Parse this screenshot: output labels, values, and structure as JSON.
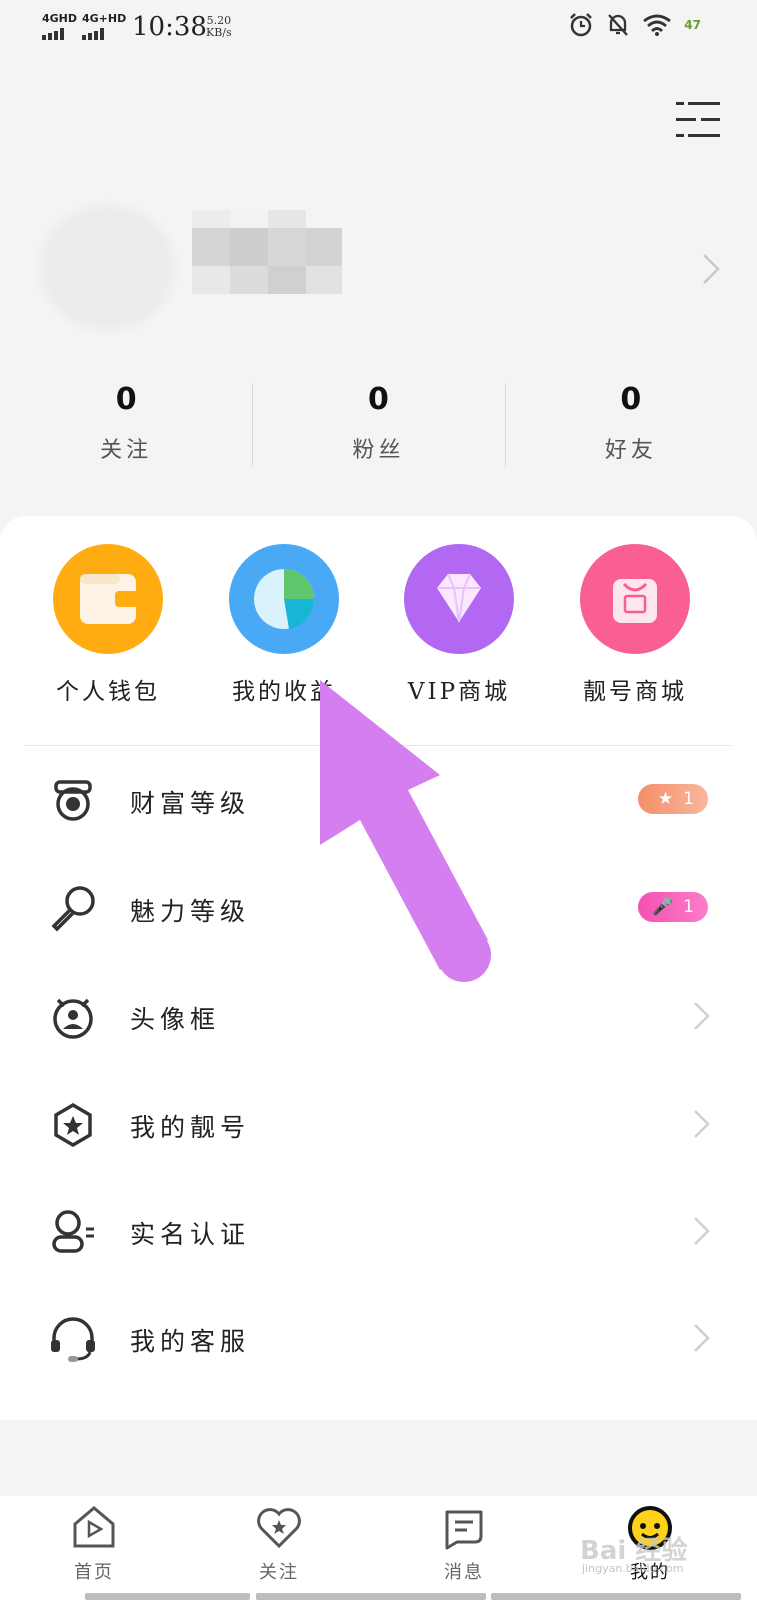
{
  "status_bar": {
    "network1": "4GHD",
    "network2": "4G+HD",
    "time": "10:38",
    "speed_value": "5.20",
    "speed_unit": "KB/s",
    "battery": "47",
    "icons": [
      "alarm-icon",
      "mute-icon",
      "wifi-icon",
      "battery-icon"
    ]
  },
  "stats": [
    {
      "value": "0",
      "label": "关注"
    },
    {
      "value": "0",
      "label": "粉丝"
    },
    {
      "value": "0",
      "label": "好友"
    }
  ],
  "quick_actions": [
    {
      "label": "个人钱包",
      "icon": "wallet-icon",
      "color": "#ffac12"
    },
    {
      "label": "我的收益",
      "icon": "pie-chart-icon",
      "color": "#4aa9f5"
    },
    {
      "label": "VIP商城",
      "icon": "diamond-icon",
      "color": "#b268f3"
    },
    {
      "label": "靓号商城",
      "icon": "shopping-bag-icon",
      "color": "#f95f92"
    }
  ],
  "menu": [
    {
      "label": "财富等级",
      "icon": "wealth-level-icon",
      "badge": "1",
      "badge_color": "#f48f6a"
    },
    {
      "label": "魅力等级",
      "icon": "microphone-icon",
      "badge": "1",
      "badge_color": "#f64fb3"
    },
    {
      "label": "头像框",
      "icon": "avatar-frame-icon"
    },
    {
      "label": "我的靓号",
      "icon": "star-badge-icon"
    },
    {
      "label": "实名认证",
      "icon": "id-verify-icon"
    },
    {
      "label": "我的客服",
      "icon": "headset-icon"
    }
  ],
  "tabs": [
    {
      "label": "首页",
      "icon": "home-icon"
    },
    {
      "label": "关注",
      "icon": "heart-star-icon"
    },
    {
      "label": "消息",
      "icon": "message-icon"
    },
    {
      "label": "我的",
      "icon": "profile-face-icon",
      "active": true
    }
  ],
  "watermark": {
    "text": "Bai 经验",
    "sub": "jingyan.baidu.com"
  },
  "colors": {
    "annotation_arrow": "#d57ef0",
    "background": "#f4f4f4"
  }
}
